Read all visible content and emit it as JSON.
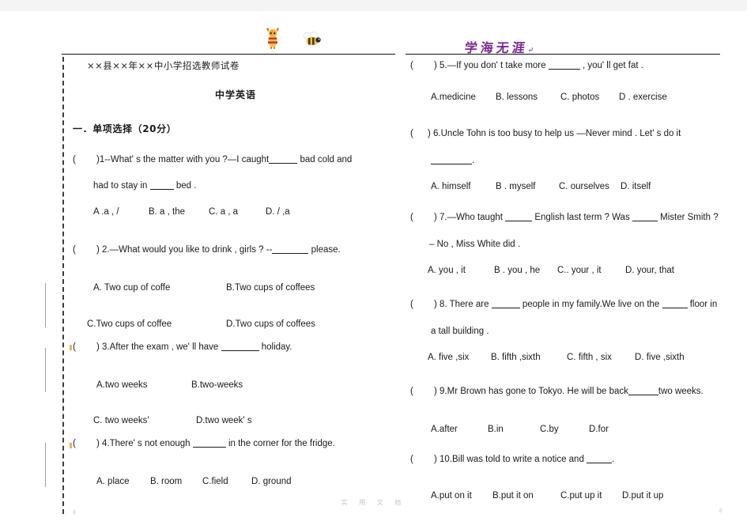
{
  "document": {
    "title": "××县××年××中小学招选教师试卷",
    "subtitle": "中学英语",
    "section_heading": "一．单项选择（20分）",
    "calligraphy": "学海无涯",
    "calligraphy_mark": "↵",
    "footer_watermark": "实 用 文 档",
    "corner_mark": "6",
    "corner_mark_left": "纟"
  },
  "ornaments": {
    "mascot": "bee-mascot-icon",
    "bee": "bee-icon"
  },
  "colors": {
    "calligraphy_purple": "#7b2d8e",
    "text": "#1b1b1b",
    "rule": "#111111",
    "watermark": "#c9c4c0",
    "margin_bar": "#9aa0a6",
    "edge_tick": "#e8a33d"
  },
  "questions_left": [
    {
      "number": "1",
      "paren": "（    ）",
      "stem": ")1--What' s the matter with you ?—I caught",
      "stem_tail": "bad  cold  and",
      "continuation_pre": "had to stay in",
      "continuation_post": "bed .",
      "options_rows": [
        [
          "A .a , /",
          "B. a , the",
          "C. a , a",
          "D. / ,a"
        ]
      ]
    },
    {
      "number": "2",
      "stem": ") 2.—What would you like to drink , girls ? --",
      "stem_tail": "please.",
      "options_rows": [
        [
          "A. Two cup of coffe",
          "B.Two cups of coffees"
        ],
        [
          "C.Two cups of coffee",
          "D.Two cups of coffees"
        ]
      ]
    },
    {
      "number": "3",
      "stem": ") 3.After the exam , we' ll have",
      "stem_tail": "holiday.",
      "options_rows": [
        [
          "A.two weeks",
          "B.two-weeks"
        ],
        [
          "C. two weeks'",
          "D.two week' s"
        ]
      ]
    },
    {
      "number": "4",
      "stem": ") 4.There' s not enough",
      "stem_tail": "in the corner for the fridge.",
      "options_rows": [
        [
          "A. place",
          "B. room",
          "C.field",
          "D. ground"
        ]
      ]
    }
  ],
  "questions_right": [
    {
      "number": "5",
      "stem": ") 5.—If you don' t take more",
      "stem_tail": ", you' ll get fat .",
      "options_rows": [
        [
          "A.medicine",
          "B.  lessons",
          "C. photos",
          "D . exercise"
        ]
      ]
    },
    {
      "number": "6",
      "stem": ") 6.Uncle Tohn  is  too  busy  to  help  us  —Never  mind . Let' s  do  it",
      "continuation_post": ".",
      "options_rows": [
        [
          "A. himself",
          "B . myself",
          "C. ourselves",
          "D. itself"
        ]
      ]
    },
    {
      "number": "7",
      "stem_a": ") 7.—Who taught",
      "stem_b": "English last term ? Was",
      "stem_c": "Mister Smith ?",
      "continuation_post": "– No , Miss White did .",
      "options_rows": [
        [
          "A. you , it",
          "B . you , he",
          "C.. your , it",
          "D. your, that"
        ]
      ]
    },
    {
      "number": "8",
      "stem_a": ") 8. There are",
      "stem_b": "people in my family.We live on the",
      "stem_c": "floor in",
      "continuation_post": "a tall building .",
      "options_rows": [
        [
          "A. five ,six",
          "B. fifth ,sixth",
          "C. fifth , six",
          "D. five ,sixth"
        ]
      ]
    },
    {
      "number": "9",
      "stem": ") 9.Mr Brown has gone to Tokyo. He will be back",
      "stem_tail": "two weeks.",
      "options_rows": [
        [
          "A.after",
          "B.in",
          "C.by",
          "D.for"
        ]
      ]
    },
    {
      "number": "10",
      "stem": ") 10.Bill was told to write a notice and",
      "stem_tail": ".",
      "options_rows": [
        [
          "A.put on it",
          "B.put it on",
          "C.put up it",
          "D.put it up"
        ]
      ]
    }
  ]
}
